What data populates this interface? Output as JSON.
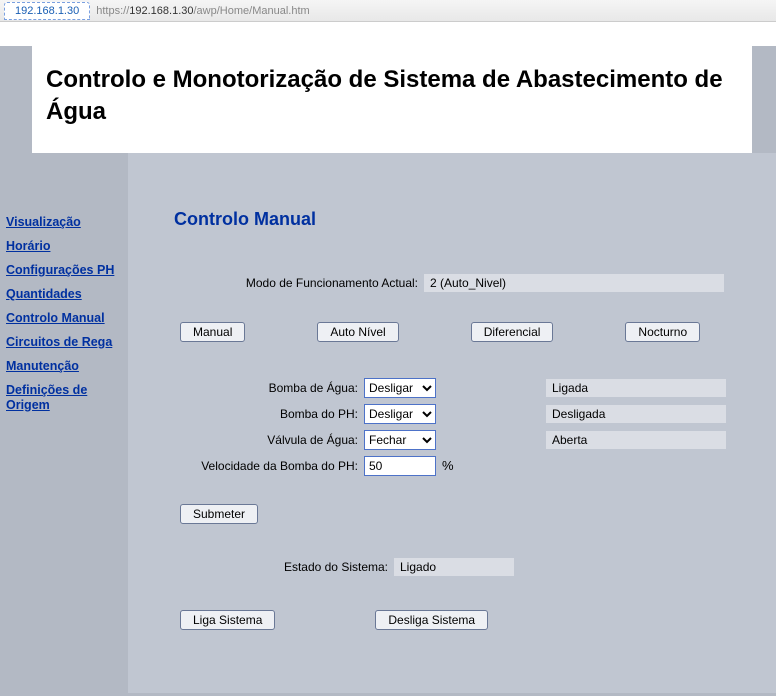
{
  "browser": {
    "tab_label": "192.168.1.30",
    "url_prefix": "https://",
    "url_host": "192.168.1.30",
    "url_path": "/awp/Home/Manual.htm"
  },
  "title": "Controlo e Monotorização de Sistema de Abastecimento de Água",
  "sidebar": {
    "items": [
      {
        "label": "Visualização"
      },
      {
        "label": "Horário"
      },
      {
        "label": "Configurações PH"
      },
      {
        "label": "Quantidades"
      },
      {
        "label": "Controlo Manual"
      },
      {
        "label": "Circuitos de Rega"
      },
      {
        "label": "Manutenção"
      },
      {
        "label": "Definições de Origem"
      }
    ]
  },
  "content": {
    "heading": "Controlo Manual",
    "modo_label": "Modo de Funcionamento Actual:",
    "modo_value": "2 (Auto_Nivel)",
    "buttons": {
      "manual": "Manual",
      "auto_nivel": "Auto Nível",
      "diferencial": "Diferencial",
      "nocturno": "Nocturno"
    },
    "fields": {
      "bomba_agua_label": "Bomba de Água:",
      "bomba_agua_value": "Desligar",
      "bomba_agua_status": "Ligada",
      "bomba_ph_label": "Bomba do PH:",
      "bomba_ph_value": "Desligar",
      "bomba_ph_status": "Desligada",
      "valvula_label": "Válvula de Água:",
      "valvula_value": "Fechar",
      "valvula_status": "Aberta",
      "veloc_label": "Velocidade da Bomba do PH:",
      "veloc_value": "50",
      "pct": "%"
    },
    "submit": "Submeter",
    "estado_label": "Estado do Sistema:",
    "estado_value": "Ligado",
    "liga": "Liga Sistema",
    "desliga": "Desliga Sistema"
  }
}
